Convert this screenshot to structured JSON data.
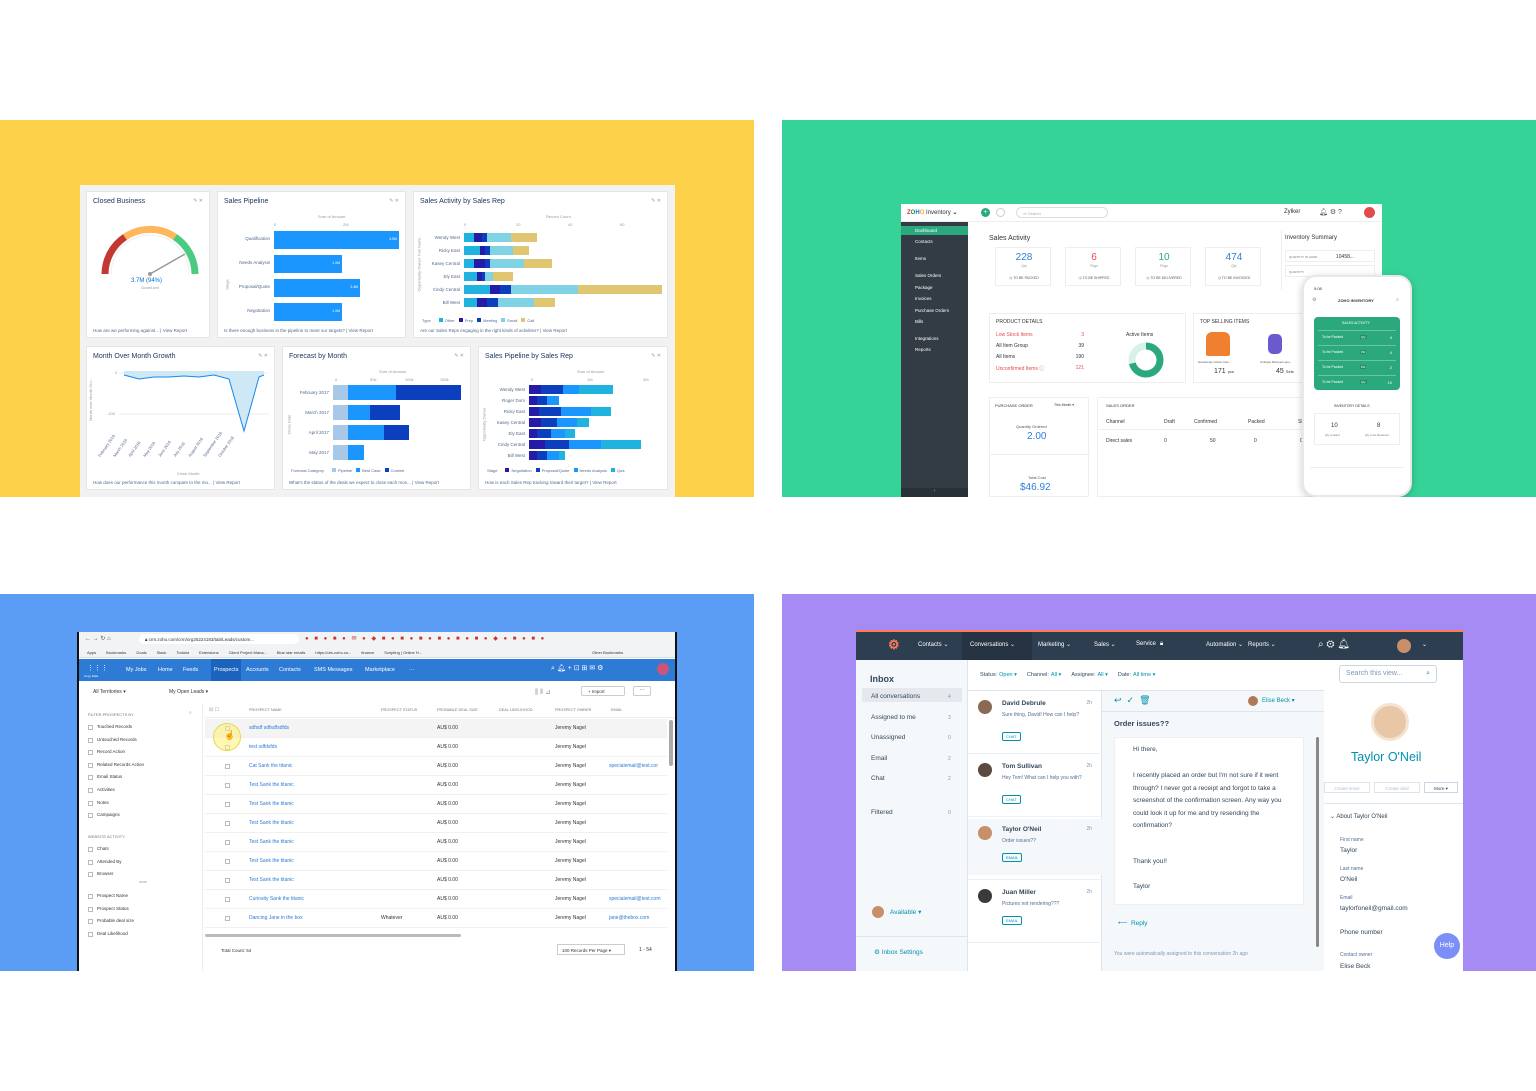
{
  "colors": {
    "yellow": "#fdd14a",
    "green": "#36d399",
    "blue": "#5b9cf5",
    "purple": "#a78bf5",
    "sf_blue1": "#1b96ff",
    "sf_blue2": "#0c3fbd",
    "sf_blue3": "#241ca8",
    "sf_cyan": "#20b3e0",
    "sf_olive": "#e0c670",
    "zoho_dark": "#333b45",
    "zoho_green": "#2ca97c",
    "hub_dark": "#2d3e50"
  },
  "salesforce": {
    "closed_business": {
      "title": "Closed Business",
      "value": "3.7M (94%)",
      "sub": "Closed Amt",
      "footer": "How are we performing against... | View Report"
    },
    "sales_pipeline": {
      "title": "Sales Pipeline",
      "axis": "Sum of Amount",
      "ylabel": "Stage",
      "ticks": [
        "0",
        "2M"
      ],
      "rows": [
        {
          "label": "Qualification",
          "value": "3.5M"
        },
        {
          "label": "Needs Analysis",
          "value": "1.9M"
        },
        {
          "label": "Proposal/Quote",
          "value": "2.4M"
        },
        {
          "label": "Negotiation",
          "value": "1.9M"
        }
      ],
      "footer": "Is there enough business in the pipeline to meet our targets? | View Report"
    },
    "activity": {
      "title": "Sales Activity by Sales Rep",
      "axis": "Record Count",
      "ylabel": "Opportunity Owner: Full Name",
      "ticks": [
        "0",
        "20",
        "40",
        "60"
      ],
      "reps": [
        "Wendy West",
        "Ricky East",
        "Kasey Central",
        "Ely East",
        "Cindy Central",
        "Bill West"
      ],
      "legend_title": "Type",
      "legend": [
        "Other",
        "Prep",
        "Meeting",
        "Email",
        "Call"
      ],
      "footer": "Are our Sales Reps engaging in the right kinds of activities? | View Report"
    },
    "mom": {
      "title": "Month Over Month Growth",
      "ylabel": "Month over Month Gro...",
      "ticks_y": [
        "0",
        "-100"
      ],
      "months": [
        "February 2016",
        "March 2016",
        "April 2016",
        "May 2016",
        "June 2016",
        "July 2016",
        "August 2016",
        "September 2016",
        "October 2016"
      ],
      "xlabel": "Close Month",
      "footer": "How does our performance this month compare to the mo... | View Report"
    },
    "forecast": {
      "title": "Forecast by Month",
      "axis": "Sum of Amount",
      "ylabel": "Close Date",
      "ticks": [
        "0",
        "50k",
        "100k",
        "150k"
      ],
      "rows": [
        "February 2017",
        "March 2017",
        "April 2017",
        "May 2017"
      ],
      "legend_title": "Forecast Category",
      "legend": [
        "Pipeline",
        "Best Case",
        "Commit"
      ],
      "footer": "What's the status of the deals we expect to close each mon... | View Report"
    },
    "pipeline_rep": {
      "title": "Sales Pipeline by Sales Rep",
      "axis": "Sum of Amount",
      "ylabel": "Opportunity Owner",
      "ticks": [
        "0",
        "1M",
        "2M"
      ],
      "reps": [
        "Wendy West",
        "Roger Dom",
        "Ricky East",
        "Kasey Central",
        "Ely East",
        "Cindy Central",
        "Bill West"
      ],
      "legend_title": "Stage",
      "legend": [
        "Negotiation",
        "Proposal/Quote",
        "Needs Analysis",
        "Qua"
      ],
      "footer": "How is each Sales Rep tracking toward their target? | View Report"
    }
  },
  "zoho_inventory": {
    "app": "Inventory",
    "org": "Zylker",
    "search": "Search",
    "nav": [
      "Dashboard",
      "Contacts",
      "Items",
      "Sales Orders",
      "Package",
      "Invoices",
      "Purchase Orders",
      "Bills",
      "Integrations",
      "Reports"
    ],
    "sales_activity": {
      "title": "Sales Activity",
      "cards": [
        {
          "n": "228",
          "u": "Qty",
          "l": "TO BE PACKED",
          "c": "#2f7ed8"
        },
        {
          "n": "6",
          "u": "Pkgs",
          "l": "TO BE SHIPPED",
          "c": "#e24b4b"
        },
        {
          "n": "10",
          "u": "Pkgs",
          "l": "TO BE DELIVERED",
          "c": "#2ca97c"
        },
        {
          "n": "474",
          "u": "Qty",
          "l": "TO BE INVOICED",
          "c": "#2f7ed8"
        }
      ]
    },
    "summary": {
      "title": "Inventory Summary",
      "row1_label": "QUANTITY IN HAND",
      "row1_value": "10458...",
      "row2_label": "QUANTITY"
    },
    "product_details": {
      "title": "PRODUCT DETAILS",
      "rows": [
        {
          "l": "Low Stock Items",
          "v": "3",
          "red": true
        },
        {
          "l": "All Item Group",
          "v": "39",
          "red": false
        },
        {
          "l": "All Items",
          "v": "190",
          "red": false
        },
        {
          "l": "Unconfirmed Items ⓘ",
          "v": "121",
          "red": true
        }
      ],
      "active": "Active Items",
      "pct": "71%"
    },
    "top_selling": {
      "title": "TOP SELLING ITEMS",
      "items": [
        {
          "name": "Hanswooly Cotton Cas...",
          "qty": "171",
          "unit": "pcs"
        },
        {
          "name": "Cutiepie Rompers-spo...",
          "qty": "45",
          "unit": "Sets"
        }
      ]
    },
    "purchase_order": {
      "title": "PURCHASE ORDER",
      "period": "This Month ▾",
      "q_label": "Quantity Ordered",
      "q_value": "2.00",
      "c_label": "Total Cost",
      "c_value": "$46.92"
    },
    "sales_order": {
      "title": "SALES ORDER",
      "cols": [
        "Channel",
        "Draft",
        "Confirmed",
        "Packed",
        "Shipp"
      ],
      "row": [
        "Direct sales",
        "0",
        "50",
        "0",
        "0"
      ]
    },
    "mobile": {
      "time": "5:08",
      "title": "ZOHO INVENTORY",
      "section": "SALES ACTIVITY",
      "rows": [
        {
          "l": "To be Packed",
          "t": "Qty",
          "v": "4"
        },
        {
          "l": "To be Packed",
          "t": "Pkt",
          "v": "4"
        },
        {
          "l": "To be Packed",
          "t": "Pkt",
          "v": "2"
        },
        {
          "l": "To be Packed",
          "t": "Qty",
          "v": "10"
        }
      ],
      "details": "INVENTORY DETAILS",
      "d1_v": "10",
      "d1_l": "Qty in Hand",
      "d2_v": "8",
      "d2_l": "Qty to be Received"
    }
  },
  "zoho_crm": {
    "url": "crm.zoho.com/crm/org2522418​3/tab/Leads/custom...",
    "bookmarks": [
      "Apps",
      "Bookmarks",
      "Goals",
      "Slack",
      "Todoist",
      "Extensions",
      "Client Project Mana...",
      "Blue star emails",
      "https://drs.zoho.co...",
      "finance",
      "Scripting | Online H...",
      "Other Bookmarks"
    ],
    "nav": [
      "My Jobs",
      "Home",
      "Feeds",
      "Prospects",
      "Accounts",
      "Contacts",
      "SMS Messages",
      "Marketplace",
      "···"
    ],
    "copy_data": "Copy Data",
    "territory": "All Territories ▾",
    "view": "My Open Leads ▾",
    "import": "Import",
    "filter_title": "FILTER PROSPECTS BY",
    "filters": [
      "Touched Records",
      "Untouched Records",
      "Record Action",
      "Related Records Action",
      "Email Status",
      "Activities",
      "Notes",
      "Campaigns"
    ],
    "website_title": "WEBSITE ACTIVITY",
    "website": [
      "Chats",
      "Attended By",
      "Browser"
    ],
    "more": "more",
    "fields": [
      "Prospect Name",
      "Prospect Status",
      "Probable deal size",
      "Deal Likelihood"
    ],
    "cols": [
      "PROSPECT NAME",
      "PROSPECT STATUS",
      "PROBABLE DEAL SIZE",
      "DEAL LIKELIHOOD",
      "PROSPECT OWNER",
      "EMAIL"
    ],
    "rows": [
      {
        "name": "sdfsdf sdfsdfsdfds",
        "status": "",
        "size": "AU$ 0.00",
        "owner": "Jeremy Nagel",
        "email": ""
      },
      {
        "name": "test sdfdsfds",
        "status": "",
        "size": "AU$ 0.00",
        "owner": "Jeremy Nagel",
        "email": ""
      },
      {
        "name": "Cat Sank the titanic",
        "status": "",
        "size": "AU$ 0.00",
        "owner": "Jeremy Nagel",
        "email": "specialemail@test.cor"
      },
      {
        "name": "Test Sank the titanic",
        "status": "",
        "size": "AU$ 0.00",
        "owner": "Jeremy Nagel",
        "email": ""
      },
      {
        "name": "Test Sank the titanic",
        "status": "",
        "size": "AU$ 0.00",
        "owner": "Jeremy Nagel",
        "email": ""
      },
      {
        "name": "Test Sank the titanic",
        "status": "",
        "size": "AU$ 0.00",
        "owner": "Jeremy Nagel",
        "email": ""
      },
      {
        "name": "Test Sank the titanic",
        "status": "",
        "size": "AU$ 0.00",
        "owner": "Jeremy Nagel",
        "email": ""
      },
      {
        "name": "Test Sank the titanic",
        "status": "",
        "size": "AU$ 0.00",
        "owner": "Jeremy Nagel",
        "email": ""
      },
      {
        "name": "Test Sank the titanic",
        "status": "",
        "size": "AU$ 0.00",
        "owner": "Jeremy Nagel",
        "email": ""
      },
      {
        "name": "Curiosity Sank the titanic",
        "status": "",
        "size": "AU$ 0.00",
        "owner": "Jeremy Nagel",
        "email": "specialemail@test.com"
      },
      {
        "name": "Dancing Jane in the box",
        "status": "Whatever",
        "size": "AU$ 0.00",
        "owner": "Jeremy Nagel",
        "email": "jane@thebox.com"
      }
    ],
    "total": "Total Count: 54",
    "per_page": "100 Records Per Page ▾",
    "pages": "1 - 54"
  },
  "hubspot": {
    "nav": [
      "Contacts ⌄",
      "Conversations ⌄",
      "Marketing ⌄",
      "Sales ⌄",
      "Service",
      "Automation ⌄",
      "Reports ⌄"
    ],
    "inbox": "Inbox",
    "folders": [
      {
        "l": "All conversations",
        "n": "4"
      },
      {
        "l": "Assigned to me",
        "n": "3"
      },
      {
        "l": "Unassigned",
        "n": "0"
      },
      {
        "l": "Email",
        "n": "2"
      },
      {
        "l": "Chat",
        "n": "2"
      },
      {
        "l": "Filtered",
        "n": "0"
      }
    ],
    "available": "Available ▾",
    "settings": "Inbox Settings",
    "filters": [
      {
        "k": "Status:",
        "v": "Open ▾"
      },
      {
        "k": "Channel:",
        "v": "All ▾"
      },
      {
        "k": "Assignee:",
        "v": "All ▾"
      },
      {
        "k": "Date:",
        "v": "All time ▾"
      }
    ],
    "search": "Search this view...",
    "convos": [
      {
        "name": "David Debrule",
        "time": "2h",
        "msg": "Sure thing, David! How can I help?",
        "tag": "CHAT"
      },
      {
        "name": "Tom Sullivan",
        "time": "2h",
        "msg": "Hey Tom! What can I help you with?",
        "tag": "CHAT"
      },
      {
        "name": "Taylor O'Neil",
        "time": "2h",
        "msg": "Order issues??",
        "tag": "EMAIL"
      },
      {
        "name": "Juan Miller",
        "time": "2h",
        "msg": "Pictures not rendering???",
        "tag": "EMAIL"
      }
    ],
    "assignee": "Elise Beck ▾",
    "subject": "Order issues??",
    "email_body": [
      "Hi there,",
      "I recently placed an order but I'm not sure if it went through? I never got a receipt and forgot to take a screenshot of the confirmation screen. Any way you could look it up for me and try resending the confirmation?",
      "Thank you!!",
      "Taylor"
    ],
    "reply": "Reply",
    "assigned_note": "You were automatically assigned to this conversation 2h ago",
    "contact": {
      "name": "Taylor O'Neil",
      "btns": [
        "Create ticket",
        "Create deal",
        "More ▾"
      ],
      "about": "About Taylor O'Neil",
      "fn_l": "First name",
      "fn": "Taylor",
      "ln_l": "Last name",
      "ln": "O'Neil",
      "em_l": "Email",
      "em": "taylorfoneil@gmail.com",
      "ph_l": "Phone number",
      "owner_l": "Contact owner",
      "owner": "Elise Beck"
    },
    "help": "Help"
  }
}
